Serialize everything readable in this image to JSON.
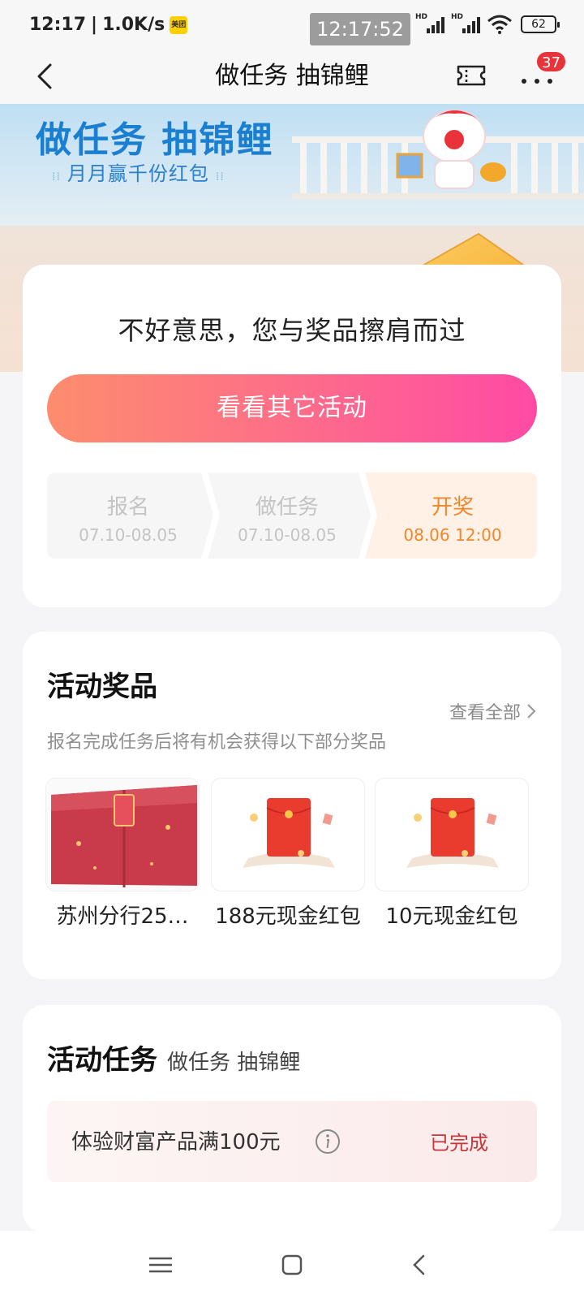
{
  "status_bar": {
    "time": "12:17",
    "speed": "1.0K/s",
    "app_badge": "美团",
    "clock_pill": "12:17:52",
    "signal1": "HD",
    "signal2": "HD",
    "battery": "62"
  },
  "nav": {
    "title": "做任务 抽锦鲤",
    "more_badge": "37"
  },
  "banner": {
    "title": "做任务 抽锦鲤",
    "subtitle": "月月赢千份红包"
  },
  "result": {
    "message": "不好意思，您与奖品擦肩而过",
    "cta_label": "看看其它活动",
    "steps": [
      {
        "name": "报名",
        "date": "07.10-08.05",
        "state": "done"
      },
      {
        "name": "做任务",
        "date": "07.10-08.05",
        "state": "done"
      },
      {
        "name": "开奖",
        "date": "08.06 12:00",
        "state": "active"
      }
    ]
  },
  "prizes": {
    "title": "活动奖品",
    "view_all": "查看全部",
    "hint": "报名完成任务后将有机会获得以下部分奖品",
    "items": [
      {
        "name": "苏州分行25…",
        "icon": "gift-box-image"
      },
      {
        "name": "188元现金红包",
        "icon": "red-envelope-image"
      },
      {
        "name": "10元现金红包",
        "icon": "red-envelope-image"
      }
    ]
  },
  "tasks": {
    "title": "活动任务",
    "subtitle": "做任务 抽锦鲤",
    "items": [
      {
        "label": "体验财富产品满100元",
        "status": "已完成"
      }
    ]
  },
  "colors": {
    "accent_orange": "#f0872a",
    "cta_start": "#fd8d6e",
    "cta_end": "#ff4aa5",
    "done_red": "#c6363c",
    "banner_blue": "#1b7fd1"
  }
}
